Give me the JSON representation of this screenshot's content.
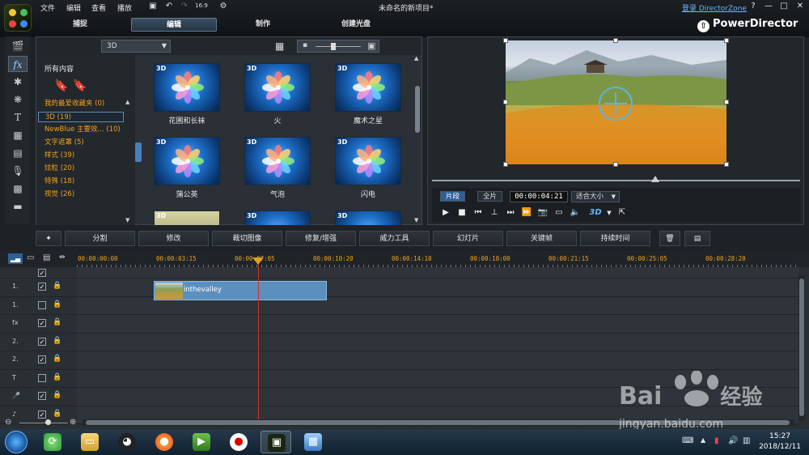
{
  "menu": {
    "file": "文件",
    "edit": "编辑",
    "view": "查看",
    "play": "播放"
  },
  "window": {
    "title": "未命名的新项目*",
    "login": "登录 DirectorZone",
    "help": "?",
    "minimize": "—",
    "maximize": "□",
    "close": "✕"
  },
  "tabs": {
    "capture": "捕捉",
    "edit": "编辑",
    "produce": "制作",
    "disc": "创建光盘"
  },
  "brand": {
    "name": "PowerDirector"
  },
  "library": {
    "filter_value": "3D",
    "category_header": "所有内容",
    "categories": [
      "我的最爱收藏夹  (0)",
      "3D  (19)",
      "NewBlue 主要效...  (10)",
      "文字遮罩  (5)",
      "样式  (39)",
      "炫粒  (20)",
      "特殊  (18)",
      "视觉  (26)"
    ],
    "selected_category": "3D  (19)",
    "thumb_tag": "3D",
    "effects": [
      "花圃和长袜",
      "火",
      "魔术之星",
      "蒲公英",
      "气泡",
      "闪电"
    ]
  },
  "preview": {
    "mode_clip": "片段",
    "mode_full": "全片",
    "timecode": "00:00:04:21",
    "fit": "适合大小",
    "threed_label": "3D"
  },
  "edit_tools": [
    "分割",
    "修改",
    "裁切图像",
    "修复/增强",
    "威力工具",
    "幻灯片",
    "关键帧",
    "持续时间"
  ],
  "timeline": {
    "ticks": [
      "00:00:00:00",
      "00:00:03:15",
      "00:00:07:05",
      "00:00:10:20",
      "00:00:14:10",
      "00:00:18:00",
      "00:00:21:15",
      "00:00:25:05",
      "00:00:28:20"
    ],
    "tracks": [
      {
        "label": "1.",
        "checked": true,
        "locked": true
      },
      {
        "label": "1.",
        "checked": false,
        "locked": true
      },
      {
        "label": "fx",
        "checked": true,
        "locked": true
      },
      {
        "label": "2.",
        "checked": true,
        "locked": true
      },
      {
        "label": "2.",
        "checked": true,
        "locked": true
      },
      {
        "label": "T",
        "checked": false,
        "locked": true
      },
      {
        "label": "🎤",
        "checked": true,
        "locked": true
      },
      {
        "label": "♪",
        "checked": true,
        "locked": true
      }
    ],
    "clip_name": "inthevalley"
  },
  "taskbar": {
    "time": "15:27",
    "date": "2018/12/11"
  },
  "watermark": {
    "brand": "Bai",
    "suffix": "经验",
    "url": "jingyan.baidu.com"
  },
  "colors": {
    "accent": "#f0a11c",
    "selection": "#2e5f96",
    "playhead": "#d0302a",
    "link": "#6fb3ff"
  }
}
